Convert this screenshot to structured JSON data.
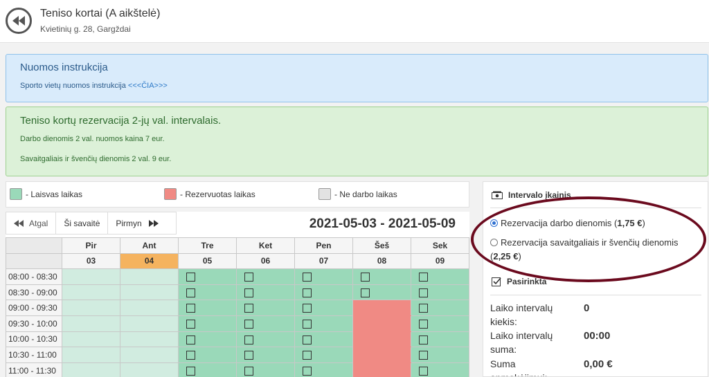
{
  "header": {
    "title": "Teniso kortai (A aikštelė)",
    "address": "Kvietinių g. 28, Gargždai"
  },
  "instructions": {
    "title": "Nuomos instrukcija",
    "text": "Sporto vietų nuomos instrukcija ",
    "link": "<<<ČIA>>>"
  },
  "pricing": {
    "title": "Teniso kortų rezervacija 2-jų val. intervalais.",
    "line1": "Darbo dienomis 2 val. nuomos kaina 7 eur.",
    "line2": "Savaitgaliais ir švenčių dienomis 2 val. 9 eur."
  },
  "legend": {
    "free": "- Laisvas laikas",
    "reserved": "- Rezervuotas laikas",
    "nonwork": "- Ne darbo laikas"
  },
  "colors": {
    "free": "#9ad9b9",
    "free_light": "#d1ece0",
    "reserved": "#f08a84",
    "nonwork": "#e2e2e2",
    "today": "#f5b35f"
  },
  "nav": {
    "prev": "Atgal",
    "current": "Ši savaitė",
    "next": "Pirmyn"
  },
  "week_range": "2021-05-03 - 2021-05-09",
  "days": [
    {
      "name": "Pir",
      "date": "03"
    },
    {
      "name": "Ant",
      "date": "04"
    },
    {
      "name": "Tre",
      "date": "05"
    },
    {
      "name": "Ket",
      "date": "06"
    },
    {
      "name": "Pen",
      "date": "07"
    },
    {
      "name": "Šeš",
      "date": "08"
    },
    {
      "name": "Sek",
      "date": "09"
    }
  ],
  "today_index": 1,
  "times": [
    "08:00 - 08:30",
    "08:30 - 09:00",
    "09:00 - 09:30",
    "09:30 - 10:00",
    "10:00 - 10:30",
    "10:30 - 11:00",
    "11:00 - 11:30"
  ],
  "slots": [
    [
      "past",
      "past",
      "free",
      "free",
      "free",
      "free",
      "free"
    ],
    [
      "past",
      "past",
      "free",
      "free",
      "free",
      "free",
      "free"
    ],
    [
      "past",
      "past",
      "free",
      "free",
      "free",
      "reserved",
      "free"
    ],
    [
      "past",
      "past",
      "free",
      "free",
      "free",
      "reserved",
      "free"
    ],
    [
      "past",
      "past",
      "free",
      "free",
      "free",
      "reserved",
      "free"
    ],
    [
      "past",
      "past",
      "free",
      "free",
      "free",
      "reserved",
      "free"
    ],
    [
      "past",
      "past",
      "free",
      "free",
      "free",
      "reserved",
      "free"
    ]
  ],
  "sidebar": {
    "price_section": "Intervalo įkainis",
    "option1": "Rezervacija darbo dienomis (",
    "option1_price": "1,75 €",
    "option1_end": ")",
    "option2": "Rezervacija savaitgaliais ir švenčių dienomis (",
    "option2_price": "2,25 €",
    "option2_end": ")",
    "selected_section": "Pasirinkta",
    "count_label": "Laiko intervalų kiekis:",
    "count_value": "0",
    "sum_label": "Laiko intervalų suma:",
    "sum_value": "00:00",
    "pay_label": "Suma apmokėjimui:",
    "pay_value": "0,00 €"
  }
}
